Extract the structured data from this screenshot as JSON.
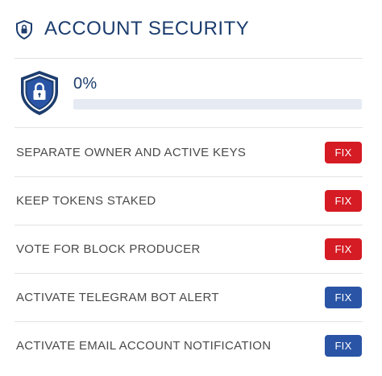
{
  "header": {
    "title": "ACCOUNT SECURITY",
    "icon": "shield-lock-icon"
  },
  "score": {
    "icon": "shield-lock-icon",
    "percent_text": "0%",
    "progress_fraction": 0.0
  },
  "colors": {
    "brand_navy": "#1c3d6e",
    "fix_red": "#d51b23",
    "fix_blue": "#2a55a6"
  },
  "items": [
    {
      "label": "SEPARATE OWNER AND ACTIVE KEYS",
      "button": "FIX",
      "button_color": "red"
    },
    {
      "label": "KEEP TOKENS STAKED",
      "button": "FIX",
      "button_color": "red"
    },
    {
      "label": "VOTE FOR BLOCK PRODUCER",
      "button": "FIX",
      "button_color": "red"
    },
    {
      "label": "ACTIVATE TELEGRAM BOT ALERT",
      "button": "FIX",
      "button_color": "blue"
    },
    {
      "label": "ACTIVATE EMAIL ACCOUNT NOTIFICATION",
      "button": "FIX",
      "button_color": "blue"
    }
  ]
}
